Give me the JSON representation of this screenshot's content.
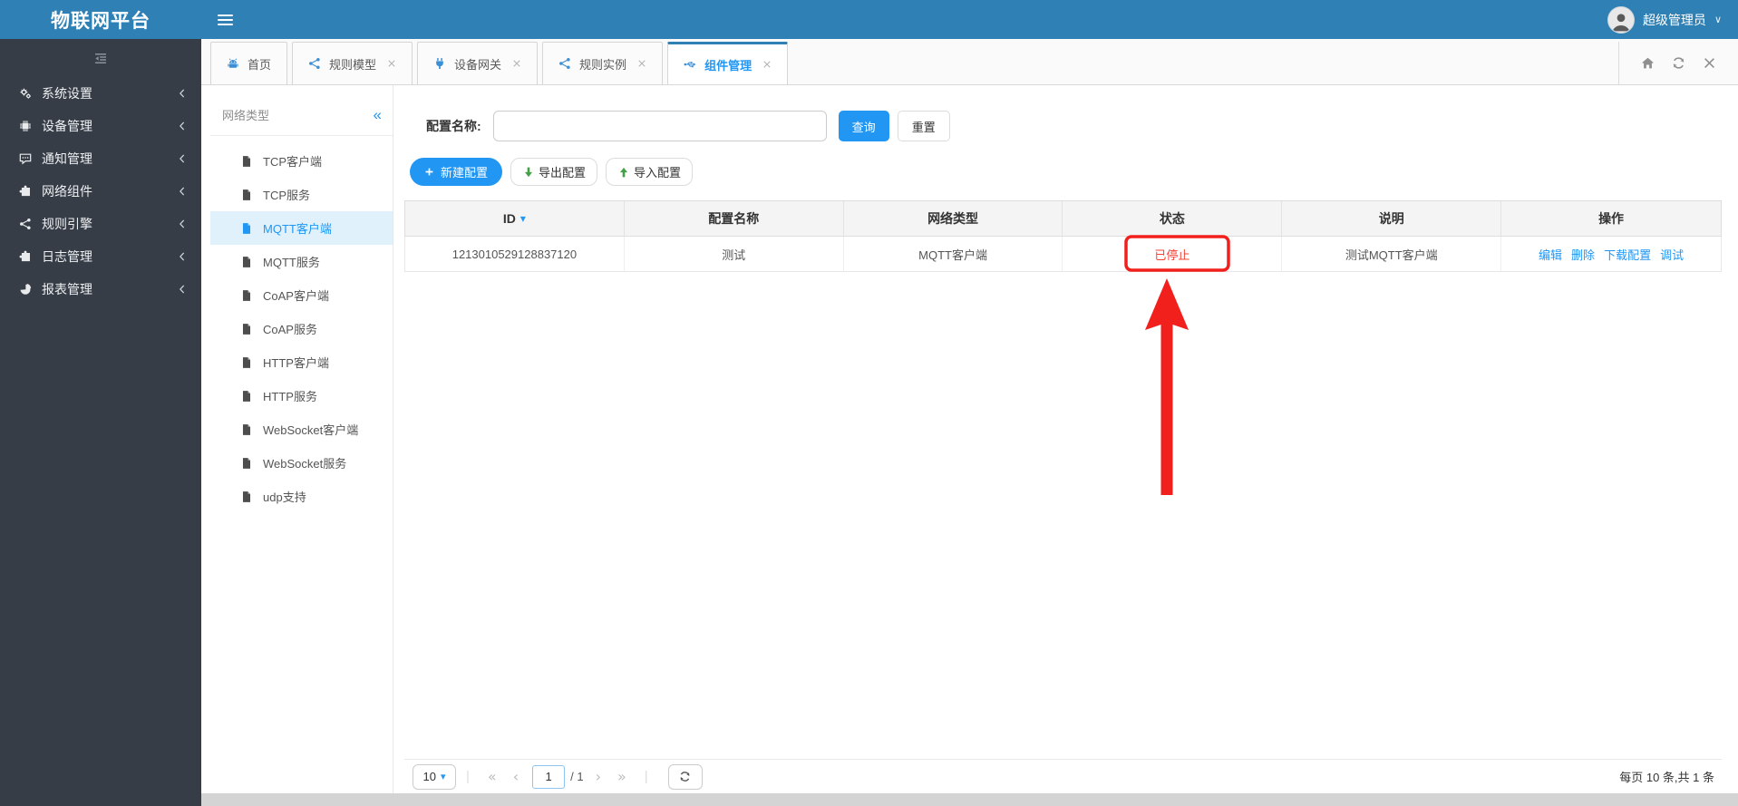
{
  "colors": {
    "header_blue": "#2e80b5",
    "sidebar_dark": "#363d47",
    "accent_blue": "#2196f3",
    "link_blue": "#2196f3",
    "status_red": "#f44336",
    "annotation_red": "#f2201d",
    "import_export_green": "#43a047"
  },
  "icons": {
    "collapse-left": "«",
    "first-page": "«",
    "prev-page": "‹",
    "next-page": "›",
    "last-page": "»",
    "user-caret": "∨",
    "sort-caret": "▾"
  },
  "app": {
    "title": "物联网平台",
    "user_name": "超级管理员"
  },
  "sidebar": {
    "items": [
      {
        "label": "系统设置",
        "icon": "gears-icon"
      },
      {
        "label": "设备管理",
        "icon": "chip-icon"
      },
      {
        "label": "通知管理",
        "icon": "comment-icon"
      },
      {
        "label": "网络组件",
        "icon": "puzzle-icon"
      },
      {
        "label": "规则引擎",
        "icon": "share-icon"
      },
      {
        "label": "日志管理",
        "icon": "puzzle-icon"
      },
      {
        "label": "报表管理",
        "icon": "pie-icon"
      }
    ]
  },
  "tabs": {
    "items": [
      {
        "label": "首页",
        "icon": "android-icon",
        "closable": false,
        "active": false
      },
      {
        "label": "规则模型",
        "icon": "share-icon",
        "closable": true,
        "active": false
      },
      {
        "label": "设备网关",
        "icon": "plug-icon",
        "closable": true,
        "active": false
      },
      {
        "label": "规则实例",
        "icon": "share-icon",
        "closable": true,
        "active": false
      },
      {
        "label": "组件管理",
        "icon": "usb-icon",
        "closable": true,
        "active": true
      }
    ]
  },
  "network_panel": {
    "title": "网络类型",
    "selected_index": 2,
    "items": [
      "TCP客户端",
      "TCP服务",
      "MQTT客户端",
      "MQTT服务",
      "CoAP客户端",
      "CoAP服务",
      "HTTP客户端",
      "HTTP服务",
      "WebSocket客户端",
      "WebSocket服务",
      "udp支持"
    ]
  },
  "search": {
    "label": "配置名称:",
    "value": "",
    "query_button": "查询",
    "reset_button": "重置"
  },
  "toolbar": {
    "new_button": "新建配置",
    "export_button": "导出配置",
    "import_button": "导入配置"
  },
  "table": {
    "headers": [
      "ID",
      "配置名称",
      "网络类型",
      "状态",
      "说明",
      "操作"
    ],
    "sorted_column": "ID",
    "rows": [
      {
        "id": "1213010529128837120",
        "name": "测试",
        "type": "MQTT客户端",
        "status": "已停止",
        "description": "测试MQTT客户端",
        "actions": [
          "编辑",
          "删除",
          "下载配置",
          "调试"
        ]
      }
    ]
  },
  "pagination": {
    "page_size": "10",
    "page": "1",
    "total_pages": "/ 1",
    "summary": "每页 10 条,共 1 条"
  }
}
